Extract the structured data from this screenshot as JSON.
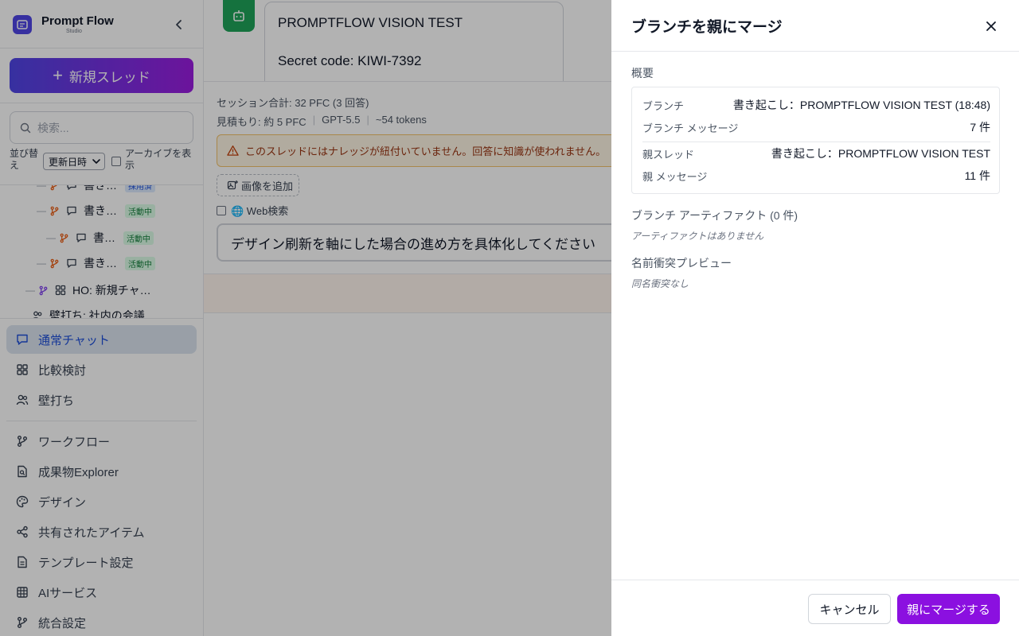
{
  "sidebar": {
    "brand_title": "Prompt Flow",
    "brand_subtitle": "Studio",
    "new_thread_label": "新規スレッド",
    "search_placeholder": "検索...",
    "sort_label": "並び替え",
    "sort_value": "更新日時",
    "archive_label": "アーカイブを表示",
    "tree": [
      {
        "label": "書き…",
        "badge": "採用済",
        "icon": "branch-icon"
      },
      {
        "label": "書き…",
        "badge": "活動中",
        "icon": "branch-icon"
      },
      {
        "label": "書…",
        "badge": "活動中",
        "icon": "branch-icon"
      },
      {
        "label": "書き…",
        "badge": "活動中",
        "icon": "branch-icon"
      },
      {
        "label": "HO: 新規チャ…",
        "icon": "grid-icon"
      },
      {
        "label": "壁打ち: 社内の会議",
        "icon": "users-icon"
      }
    ],
    "nav": [
      {
        "label": "通常チャット",
        "icon": "chat-icon",
        "active": true
      },
      {
        "label": "比較検討",
        "icon": "grid-icon"
      },
      {
        "label": "壁打ち",
        "icon": "users-icon"
      },
      {
        "label": "ワークフロー",
        "icon": "branch-icon"
      },
      {
        "label": "成果物Explorer",
        "icon": "file-search-icon"
      },
      {
        "label": "デザイン",
        "icon": "palette-icon"
      },
      {
        "label": "共有されたアイテム",
        "icon": "share-icon"
      },
      {
        "label": "テンプレート設定",
        "icon": "document-icon"
      },
      {
        "label": "AIサービス",
        "icon": "table-icon"
      },
      {
        "label": "統合設定",
        "icon": "branch-icon"
      }
    ]
  },
  "main": {
    "message_line1": "PROMPTFLOW VISION TEST",
    "message_line2": "Secret code: KIWI-7392",
    "session_total": "セッション合計: 32 PFC (3 回答)",
    "estimate": "見積もり: 約 5 PFC",
    "model": "GPT-5.5",
    "tokens": "~54 tokens",
    "warning": "このスレッドにはナレッジが紐付いていません。回答に知識が使われません。",
    "add_image": "画像を追加",
    "web_search": "🌐 Web検索",
    "prompt_text": "デザイン刷新を軸にした場合の進め方を具体化してください"
  },
  "drawer": {
    "title": "ブランチを親にマージ",
    "overview_label": "概要",
    "rows": [
      {
        "key": "ブランチ",
        "value": "書き起こし：PROMPTFLOW VISION TEST (18:48)"
      },
      {
        "key": "ブランチ メッセージ",
        "value": "7 件"
      },
      {
        "key": "親スレッド",
        "value": "書き起こし：PROMPTFLOW VISION TEST"
      },
      {
        "key": "親 メッセージ",
        "value": "11 件"
      }
    ],
    "artifacts_label": "ブランチ アーティファクト (0 件)",
    "artifacts_empty": "アーティファクトはありません",
    "conflict_label": "名前衝突プレビュー",
    "conflict_empty": "同名衝突なし",
    "cancel_label": "キャンセル",
    "merge_label": "親にマージする"
  },
  "colors": {
    "accent_purple": "#8b10e0",
    "brand_indigo": "#4f46e5",
    "active_nav_bg": "#dbe4f0",
    "bot_green": "#1fa45a",
    "warning_bg": "#fef5e4"
  }
}
